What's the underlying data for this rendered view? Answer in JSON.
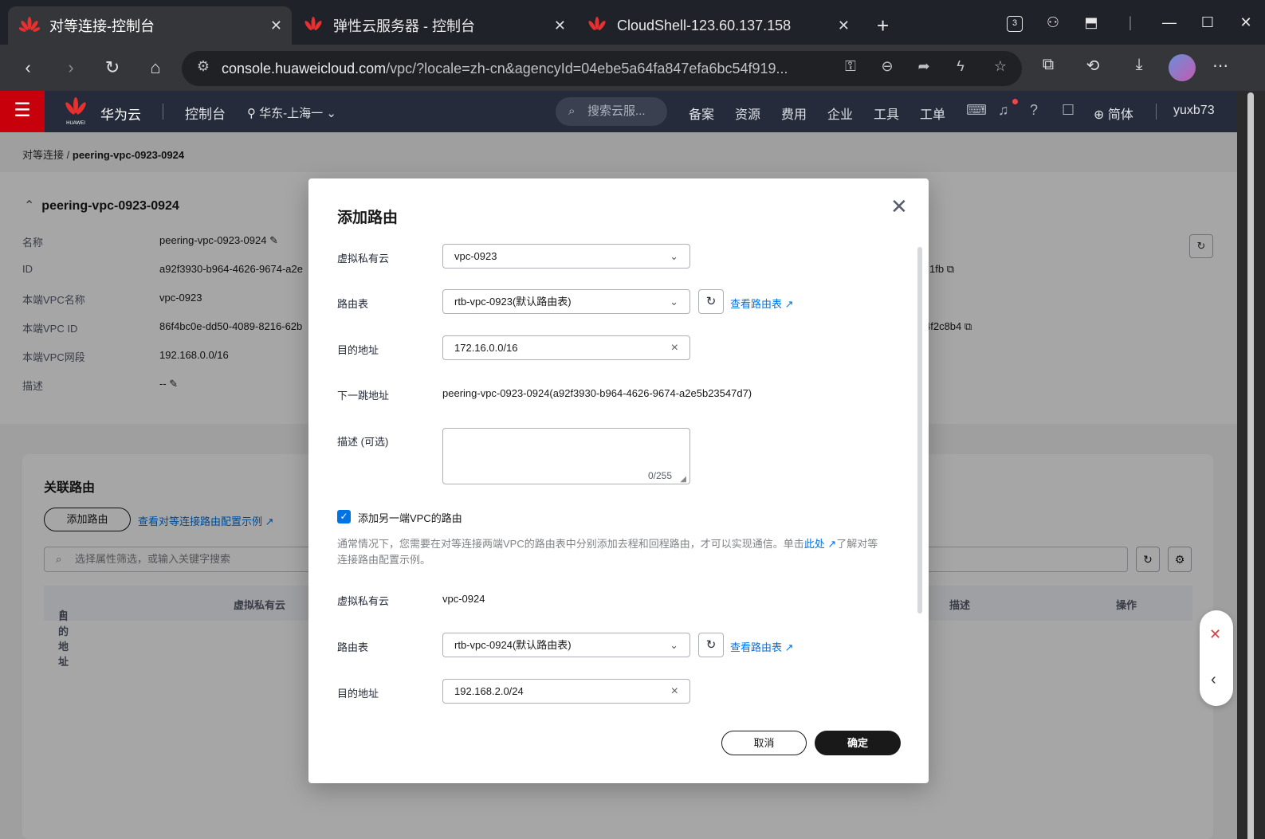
{
  "browser": {
    "tabs": [
      {
        "title": "对等连接-控制台",
        "active": true
      },
      {
        "title": "弹性云服务器 - 控制台",
        "active": false
      },
      {
        "title": "CloudShell-123.60.137.158",
        "active": false
      }
    ],
    "new_tab": "+",
    "tab_count": "3",
    "url_host": "console.huaweicloud.com",
    "url_path": "/vpc/?locale=zh-cn&agencyId=04ebe5a64fa847efa6bc54f919..."
  },
  "console": {
    "brand": "华为云",
    "logo_text": "HUAWEI",
    "console_label": "控制台",
    "region": "华东-上海一",
    "search_placeholder": "搜索云服...",
    "nav": [
      "备案",
      "资源",
      "费用",
      "企业",
      "工具",
      "工单"
    ],
    "language": "简体",
    "user": "yuxb73"
  },
  "breadcrumb": {
    "parent": "对等连接",
    "sep": "/",
    "current": "peering-vpc-0923-0924"
  },
  "detail": {
    "title": "peering-vpc-0923-0924",
    "fields": [
      {
        "label": "名称",
        "value": "peering-vpc-0923-0924"
      },
      {
        "label": "ID",
        "value": "a92f3930-b964-4626-9674-a2e"
      },
      {
        "label": "本端VPC名称",
        "value": "vpc-0923"
      },
      {
        "label": "本端VPC ID",
        "value": "86f4bc0e-dd50-4089-8216-62b"
      },
      {
        "label": "本端VPC网段",
        "value": "192.168.0.0/16"
      },
      {
        "label": "描述",
        "value": "--"
      }
    ],
    "right_fragments": [
      "1fb",
      "4f2c8b4"
    ]
  },
  "routes": {
    "title": "关联路由",
    "add_button": "添加路由",
    "example_link": "查看对等连接路由配置示例",
    "filter_placeholder": "选择属性筛选，或输入关键字搜索",
    "columns": [
      "目的地址",
      "虚拟私有云",
      "描述",
      "操作"
    ]
  },
  "dialog": {
    "title": "添加路由",
    "vpc_label": "虚拟私有云",
    "vpc_value": "vpc-0923",
    "route_table_label": "路由表",
    "route_table_value": "rtb-vpc-0923(默认路由表)",
    "view_route_table": "查看路由表",
    "dest_label": "目的地址",
    "dest_value": "172.16.0.0/16",
    "next_hop_label": "下一跳地址",
    "next_hop_value": "peering-vpc-0923-0924(a92f3930-b964-4626-9674-a2e5b23547d7)",
    "desc_label": "描述 (可选)",
    "desc_counter": "0/255",
    "add_peer_label": "添加另一端VPC的路由",
    "hint_before": "通常情况下，您需要在对等连接两端VPC的路由表中分别添加去程和回程路由，才可以实现通信。单击",
    "hint_link": "此处",
    "hint_after": "了解对等连接路由配置示例。",
    "peer_vpc_label": "虚拟私有云",
    "peer_vpc_value": "vpc-0924",
    "peer_route_table_label": "路由表",
    "peer_route_table_value": "rtb-vpc-0924(默认路由表)",
    "peer_dest_label": "目的地址",
    "peer_dest_value": "192.168.2.0/24",
    "cancel": "取消",
    "confirm": "确定"
  }
}
